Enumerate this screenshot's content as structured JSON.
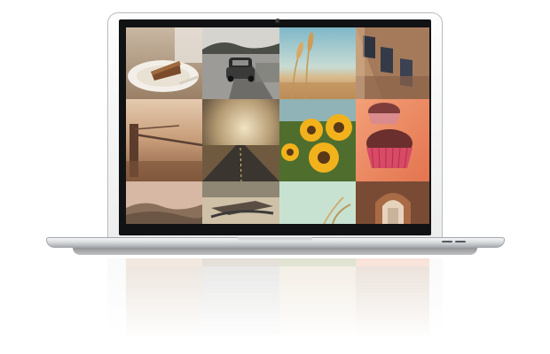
{
  "scene": "laptop-photo-collage",
  "photos": [
    {
      "id": "cake-slice",
      "row": 1,
      "col": 1
    },
    {
      "id": "vintage-car",
      "row": 1,
      "col": 2
    },
    {
      "id": "wheat-sky",
      "row": 1,
      "col": 3
    },
    {
      "id": "old-building",
      "row": 1,
      "col": 4
    },
    {
      "id": "fence-field",
      "row": 2,
      "col": 1
    },
    {
      "id": "desert-road",
      "row": 2,
      "col": 2
    },
    {
      "id": "sunflowers",
      "row": 2,
      "col": 3
    },
    {
      "id": "cupcakes",
      "row": 2,
      "col": 4
    },
    {
      "id": "hills-landscape",
      "row": 3,
      "col": 1
    },
    {
      "id": "park-bench",
      "row": 3,
      "col": 2
    },
    {
      "id": "grass-sky",
      "row": 3,
      "col": 3
    },
    {
      "id": "arch-doorway",
      "row": 3,
      "col": 4
    }
  ],
  "colors": {
    "lid": "#eceded",
    "bezel": "#111214",
    "base": "#dadcdf"
  }
}
